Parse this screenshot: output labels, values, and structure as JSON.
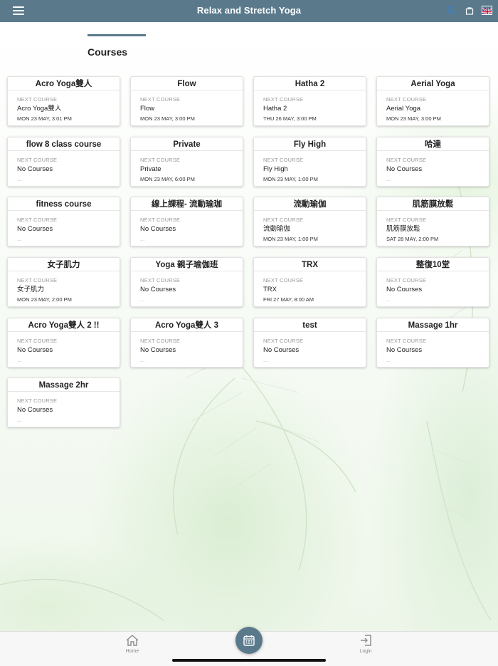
{
  "header": {
    "title": "Relax and Stretch Yoga",
    "menu_icon": "menu-icon",
    "search_icon": "search-icon",
    "cart_icon": "shopping-bag-icon",
    "language_icon": "uk-flag-icon"
  },
  "page": {
    "title": "Courses"
  },
  "next_course_label": "NEXT COURSE",
  "courses": [
    {
      "title": "Acro Yoga雙人",
      "next_name": "Acro Yoga雙人",
      "next_date": "MON 23 MAY, 3:01 PM"
    },
    {
      "title": "Flow",
      "next_name": "Flow",
      "next_date": "MON 23 MAY, 3:00 PM"
    },
    {
      "title": "Hatha 2",
      "next_name": "Hatha 2",
      "next_date": "THU 26 MAY, 3:00 PM"
    },
    {
      "title": "Aerial Yoga",
      "next_name": "Aerial Yoga",
      "next_date": "MON 23 MAY, 3:00 PM"
    },
    {
      "title": "flow 8 class course",
      "next_name": "No Courses",
      "next_date": "..."
    },
    {
      "title": "Private",
      "next_name": "Private",
      "next_date": "MON 23 MAY, 6:00 PM"
    },
    {
      "title": "Fly High",
      "next_name": "Fly High",
      "next_date": "MON 23 MAY, 1:00 PM"
    },
    {
      "title": "哈達",
      "next_name": "No Courses",
      "next_date": "..."
    },
    {
      "title": "fitness course",
      "next_name": "No Courses",
      "next_date": "..."
    },
    {
      "title": "線上課程- 流動瑜珈",
      "next_name": "No Courses",
      "next_date": "..."
    },
    {
      "title": "流動瑜伽",
      "next_name": "流動瑜伽",
      "next_date": "MON 23 MAY, 1:00 PM"
    },
    {
      "title": "肌筋膜放鬆",
      "next_name": "肌筋膜放鬆",
      "next_date": "SAT 28 MAY, 2:00 PM"
    },
    {
      "title": "女子肌力",
      "next_name": "女子肌力",
      "next_date": "MON 23 MAY, 2:00 PM"
    },
    {
      "title": "Yoga 親子瑜伽班",
      "next_name": "No Courses",
      "next_date": "..."
    },
    {
      "title": "TRX",
      "next_name": "TRX",
      "next_date": "FRI 27 MAY, 8:00 AM"
    },
    {
      "title": "整復10堂",
      "next_name": "No Courses",
      "next_date": "..."
    },
    {
      "title": "Acro Yoga雙人 2 !!",
      "next_name": "No Courses",
      "next_date": "..."
    },
    {
      "title": "Acro Yoga雙人 3",
      "next_name": "No Courses",
      "next_date": "..."
    },
    {
      "title": "test",
      "next_name": "No Courses",
      "next_date": "..."
    },
    {
      "title": "Massage 1hr",
      "next_name": "No Courses",
      "next_date": "..."
    },
    {
      "title": "Massage 2hr",
      "next_name": "No Courses",
      "next_date": "..."
    }
  ],
  "bottom_nav": {
    "home_label": "Home",
    "login_label": "Login",
    "home_icon": "home-icon",
    "login_icon": "login-icon",
    "calendar_icon": "calendar-icon"
  },
  "colors": {
    "header_bg": "#5a7a8c",
    "accent": "#5a7a8c",
    "card_bg": "#ffffff",
    "text": "#222222",
    "muted": "#9a9a9a"
  }
}
